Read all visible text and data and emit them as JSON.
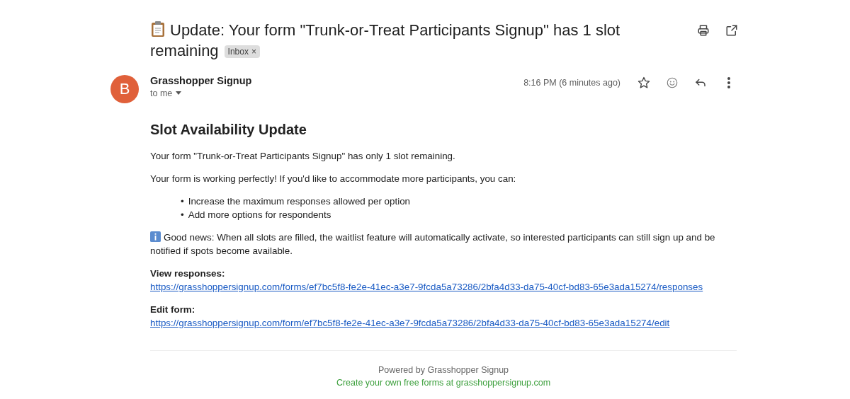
{
  "subject": {
    "title": "Update: Your form \"Trunk-or-Treat Participants Signup\" has 1 slot remaining",
    "label": "Inbox",
    "label_remove": "×"
  },
  "sender": {
    "avatar": "B",
    "name": "Grasshopper Signup",
    "recipient": "to me",
    "time": "8:16 PM (6 minutes ago)",
    "starred": false
  },
  "body": {
    "heading": "Slot Availability Update",
    "paragraphs": [
      "Your form \"Trunk-or-Treat Participants Signup\" has only 1 slot remaining.",
      "Your form is working perfectly! If you'd like to accommodate more participants, you can:"
    ],
    "bullet_marker": "•",
    "bullets": [
      "Increase the maximum responses allowed per option",
      "Add more options for respondents"
    ],
    "note": "Good news: When all slots are filled, the waitlist feature will automatically activate, so interested participants can still sign up and be notified if spots become available.",
    "links": [
      {
        "label": "View responses:",
        "url": "https://grasshoppersignup.com/forms/ef7bc5f8-fe2e-41ec-a3e7-9fcda5a73286/2bfa4d33-da75-40cf-bd83-65e3ada15274/responses"
      },
      {
        "label": "Edit form:",
        "url": "https://grasshoppersignup.com/form/ef7bc5f8-fe2e-41ec-a3e7-9fcda5a73286/2bfa4d33-da75-40cf-bd83-65e3ada15274/edit"
      }
    ]
  },
  "footer": {
    "powered": "Powered by Grasshopper Signup",
    "promo": "Create your own free forms at grasshoppersignup.com"
  }
}
